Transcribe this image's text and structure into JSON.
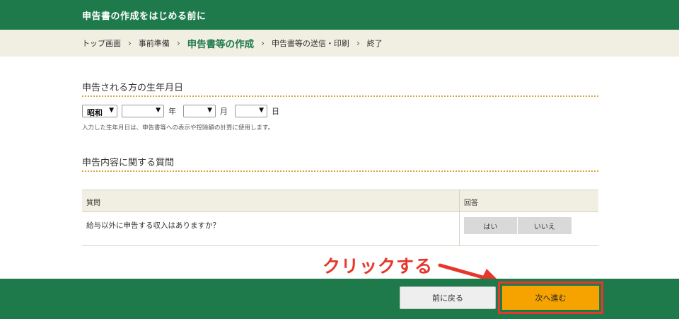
{
  "header": {
    "title": "申告書の作成をはじめる前に"
  },
  "breadcrumb": {
    "steps": [
      "トップ画面",
      "事前準備",
      "申告書等の作成",
      "申告書等の送信・印刷",
      "終了"
    ],
    "separator": "›"
  },
  "dob_section": {
    "title": "申告される方の生年月日",
    "era_value": "昭和",
    "year_value": "",
    "month_value": "",
    "day_value": "",
    "year_unit": "年",
    "month_unit": "月",
    "day_unit": "日",
    "note": "入力した生年月日は、申告書等への表示や控除額の計算に使用します。"
  },
  "question_section": {
    "title": "申告内容に関する質問",
    "col_question": "質問",
    "col_answer": "回答",
    "rows": [
      {
        "question": "給与以外に申告する収入はありますか？",
        "yes_label": "はい",
        "no_label": "いいえ"
      }
    ]
  },
  "annotation": {
    "text": "クリックする",
    "color": "#e7372c"
  },
  "footer": {
    "back_label": "前に戻る",
    "next_label": "次へ進む"
  },
  "colors": {
    "brand_green": "#1e7a4b",
    "beige": "#f1eee2",
    "next_orange": "#f6a300",
    "dotted_gold": "#d1a53c"
  }
}
